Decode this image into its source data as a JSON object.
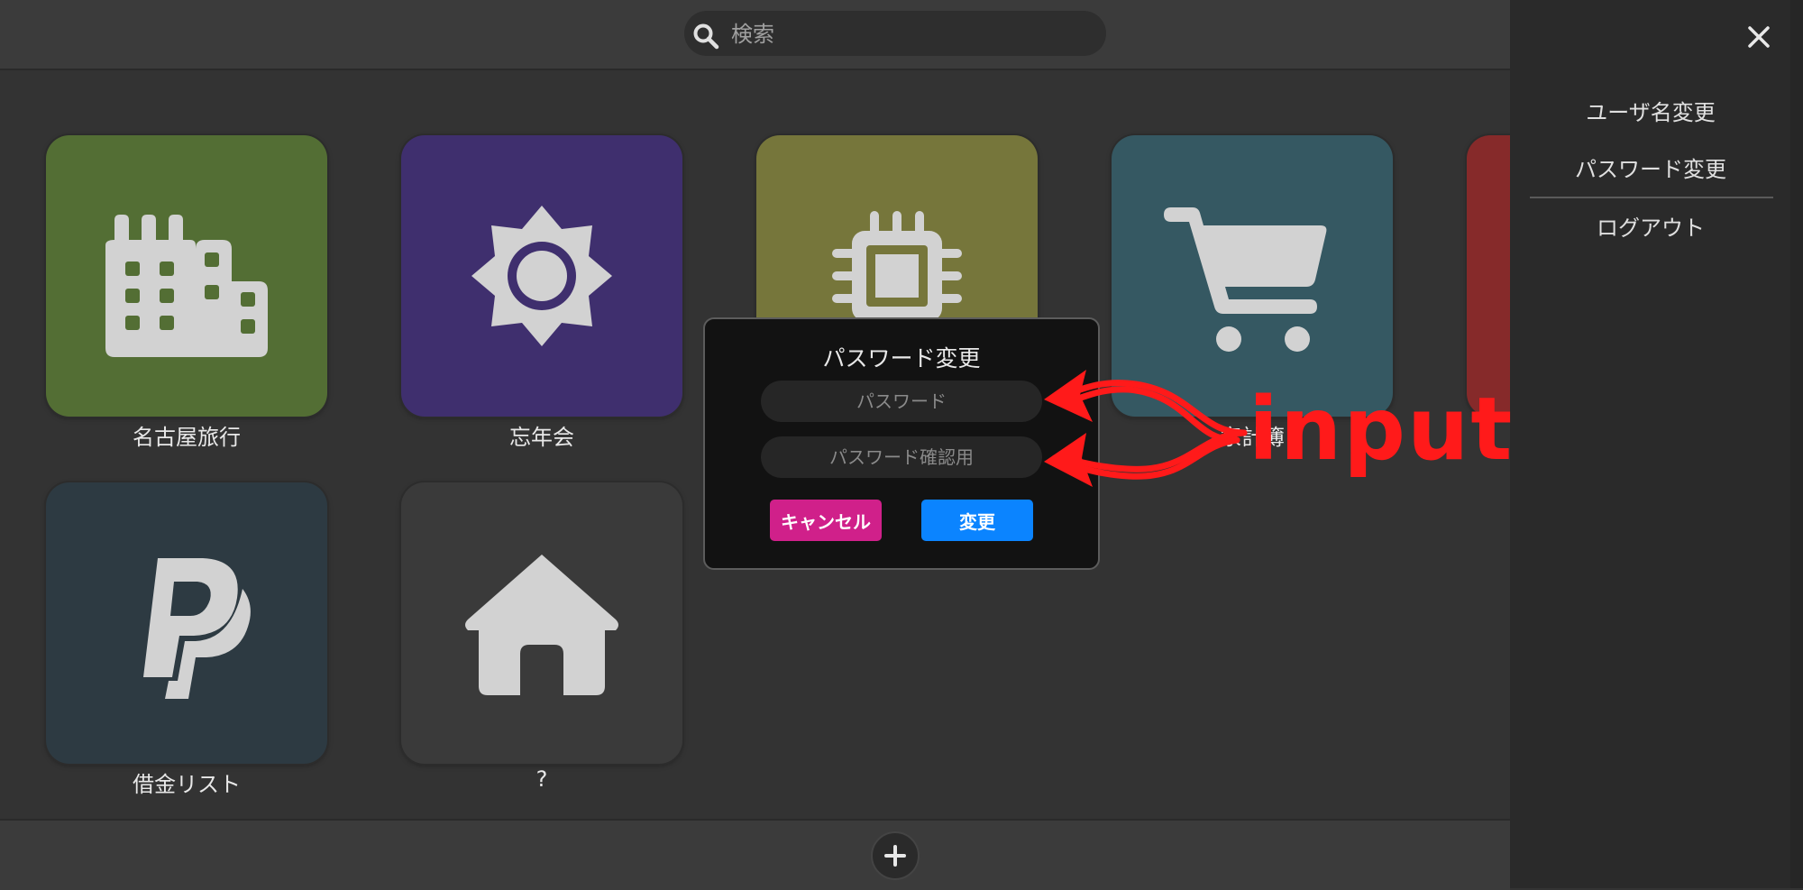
{
  "search": {
    "placeholder": "検索"
  },
  "tiles": [
    {
      "label": "名古屋旅行",
      "icon": "city-icon",
      "color": "#536e34"
    },
    {
      "label": "忘年会",
      "icon": "sun-icon",
      "color": "#3f2f6e"
    },
    {
      "label": "",
      "icon": "chip-icon",
      "color": "#76763b"
    },
    {
      "label": "家計簿",
      "icon": "cart-icon",
      "color": "#355862"
    },
    {
      "label": "",
      "icon": "",
      "color": "#862a2a"
    },
    {
      "label": "借金リスト",
      "icon": "paypal-icon",
      "color": "#2d3a42"
    },
    {
      "label": "?",
      "icon": "home-icon",
      "color": "#3a3a3a"
    }
  ],
  "side_menu": {
    "items": [
      "ユーザ名変更",
      "パスワード変更",
      "ログアウト"
    ]
  },
  "dialog": {
    "title": "パスワード変更",
    "password_placeholder": "パスワード",
    "confirm_placeholder": "パスワード確認用",
    "cancel_label": "キャンセル",
    "submit_label": "変更",
    "cancel_color": "#d0208a",
    "submit_color": "#0b84ff"
  },
  "annotation": {
    "text": "input",
    "color": "#ff1a1a"
  }
}
